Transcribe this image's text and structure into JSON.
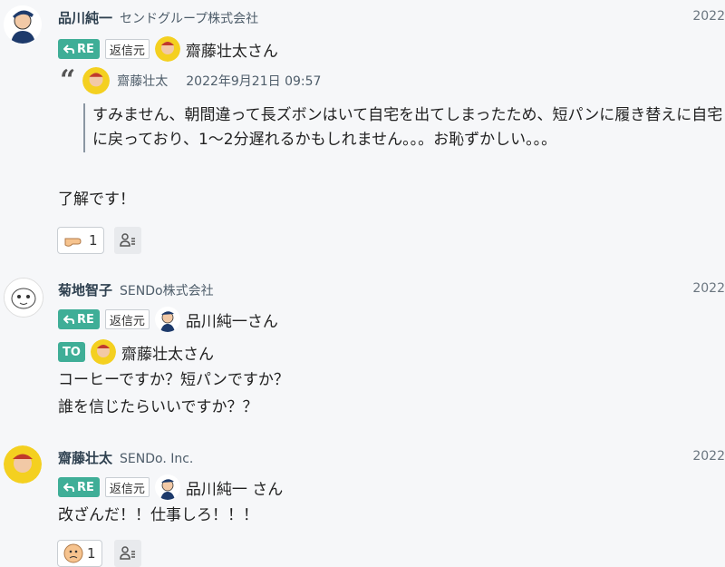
{
  "messages": [
    {
      "name": "品川純一",
      "org": "センドグループ株式会社",
      "date": "2022",
      "reply_badge": "RE",
      "reply_source": "返信元",
      "reply_to": "齋藤壮太さん",
      "quote": {
        "name": "齋藤壮太",
        "date": "2022年9月21日 09:57",
        "text": "すみません、朝間違って長ズボンはいて自宅を出てしまったため、短パンに履き替えに自宅に戻っており、1〜2分遅れるかもしれません。。。お恥ずかしい。。。"
      },
      "body": "了解です！",
      "reaction": {
        "icon": "pointing-hand-icon",
        "count": "1"
      }
    },
    {
      "name": "菊地智子",
      "org": "SENDo株式会社",
      "date": "2022",
      "reply_badge": "RE",
      "reply_source": "返信元",
      "reply_to": "品川純一さん",
      "to_badge": "TO",
      "to_name": "齋藤壮太さん",
      "body_lines": [
        "コーヒーですか？短パンですか？",
        "誰を信じたらいいですか？？"
      ]
    },
    {
      "name": "齋藤壮太",
      "org": "SENDo. Inc.",
      "date": "2022",
      "reply_badge": "RE",
      "reply_source": "返信元",
      "reply_to": "品川純一 さん",
      "body": "改ざんだ！！仕事しろ！！！",
      "reaction": {
        "icon": "sad-face-icon",
        "count": "1"
      }
    }
  ],
  "colors": {
    "badge": "#3fae97",
    "name": "#2f4150",
    "background": "#f6f7f9"
  }
}
